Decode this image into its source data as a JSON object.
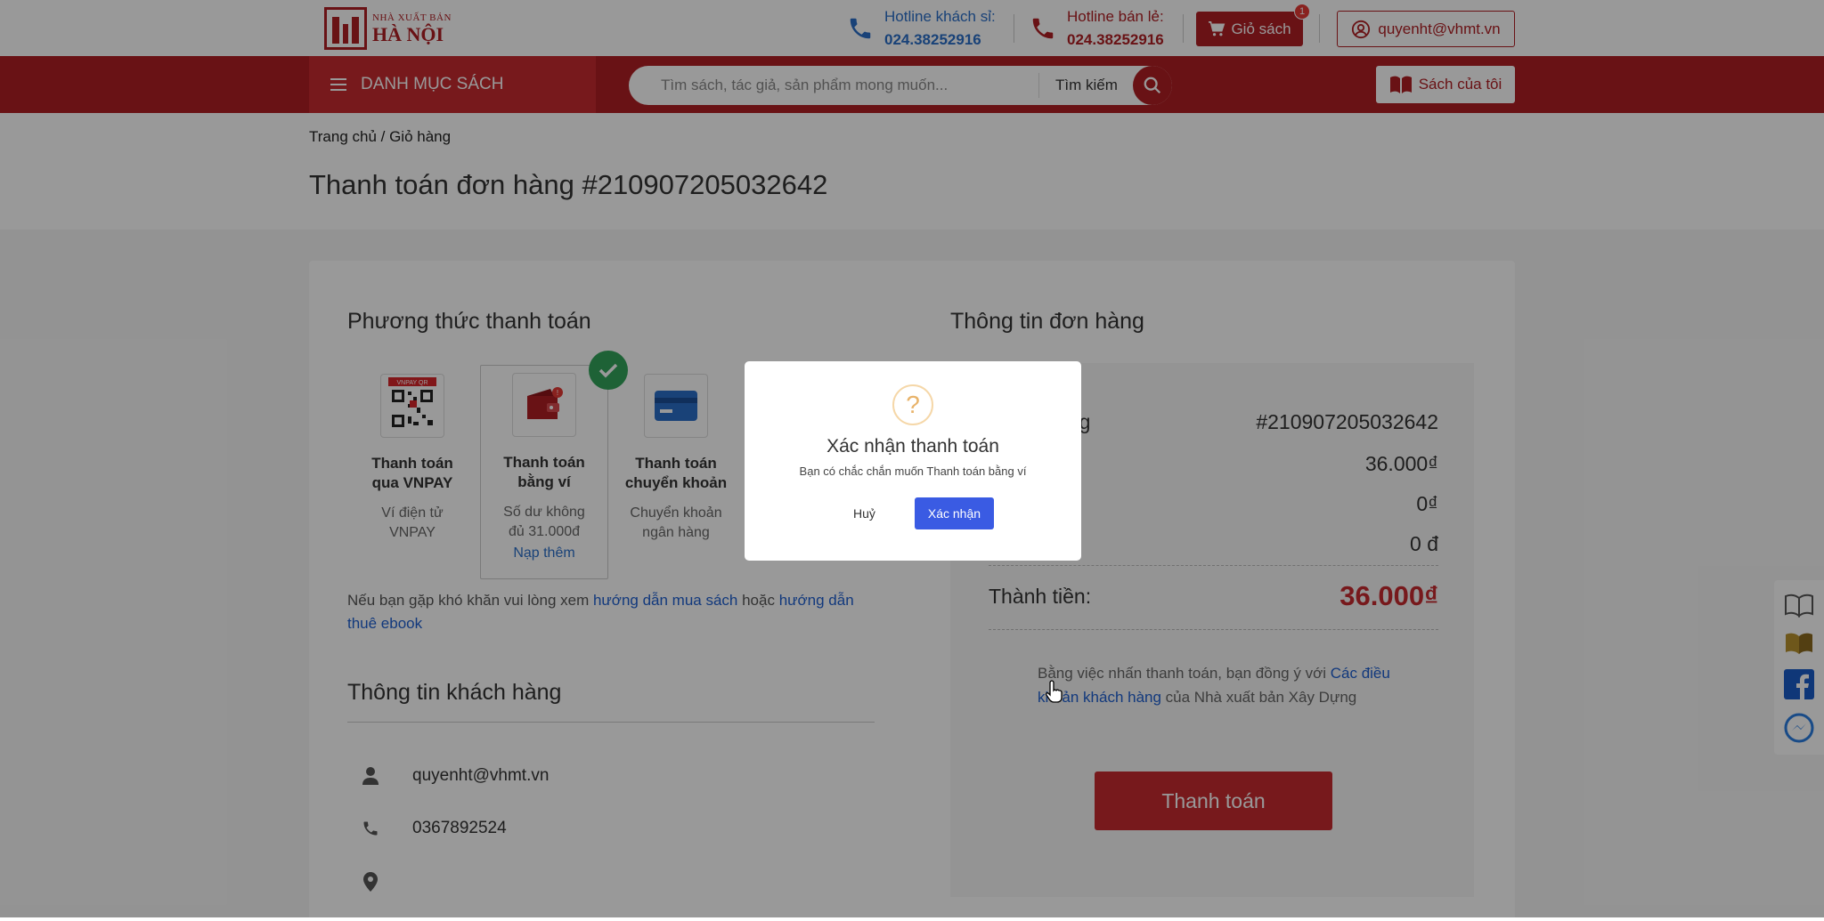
{
  "header": {
    "logo_small": "NHÀ XUẤT BẢN",
    "logo_big": "HÀ NỘI",
    "hotline_customer_label": "Hotline khách sỉ:",
    "hotline_customer_number": "024.38252916",
    "hotline_retail_label": "Hotline bán lẻ:",
    "hotline_retail_number": "024.38252916",
    "cart_label": "Giỏ sách",
    "cart_count": "1",
    "user_email": "quyenht@vhmt.vn"
  },
  "nav": {
    "category_label": "DANH MỤC SÁCH",
    "search_placeholder": "Tìm sách, tác giả, sản phẩm mong muốn...",
    "search_label": "Tìm kiếm",
    "my_books_label": "Sách của tôi"
  },
  "breadcrumb": "Trang chủ / Giỏ hàng",
  "page_title": "Thanh toán đơn hàng #210907205032642",
  "payment": {
    "title": "Phương thức thanh toán",
    "methods": [
      {
        "name_line1": "Thanh toán",
        "name_line2": "qua VNPAY",
        "desc_line1": "Ví điện tử",
        "desc_line2": "VNPAY"
      },
      {
        "name_line1": "Thanh toán",
        "name_line2": "bằng ví",
        "desc_line1": "Số dư không",
        "desc_line2": "đủ 31.000đ",
        "link": "Nạp thêm"
      },
      {
        "name_line1": "Thanh toán",
        "name_line2": "chuyển khoản",
        "desc_line1": "Chuyển khoản",
        "desc_line2": "ngân hàng"
      }
    ],
    "help_prefix": "Nếu bạn gặp khó khăn vui lòng xem ",
    "help_link1": "hướng dẫn mua sách",
    "help_mid": " hoặc ",
    "help_link2": "hướng dẫn thuê ebook"
  },
  "customer": {
    "title": "Thông tin khách hàng",
    "email": "quyenht@vhmt.vn",
    "phone": "0367892524",
    "address": ""
  },
  "order": {
    "title": "Thông tin đơn hàng",
    "order_label_partial": "ang",
    "order_code": "#210907205032642",
    "subtotal_label_partial": "",
    "subtotal": "36.000₫",
    "discount": "0₫",
    "shipping": "0 đ",
    "total_label": "Thành tiền:",
    "total": "36.000₫",
    "terms_prefix": "Bằng việc nhấn thanh toán, bạn đồng ý với ",
    "terms_link": "Các điều khoản khách hàng",
    "terms_suffix": " của Nhà xuất bản Xây Dựng",
    "pay_button": "Thanh toán"
  },
  "modal": {
    "icon": "?",
    "title": "Xác nhận thanh toán",
    "text": "Bạn có chắc chắn muốn Thanh toán bằng ví",
    "cancel": "Huỷ",
    "confirm": "Xác nhận"
  },
  "colors": {
    "brand_red": "#b01e23",
    "accent_blue": "#2a6fc9",
    "confirm_blue": "#3a5be3",
    "success_green": "#33a45b"
  }
}
